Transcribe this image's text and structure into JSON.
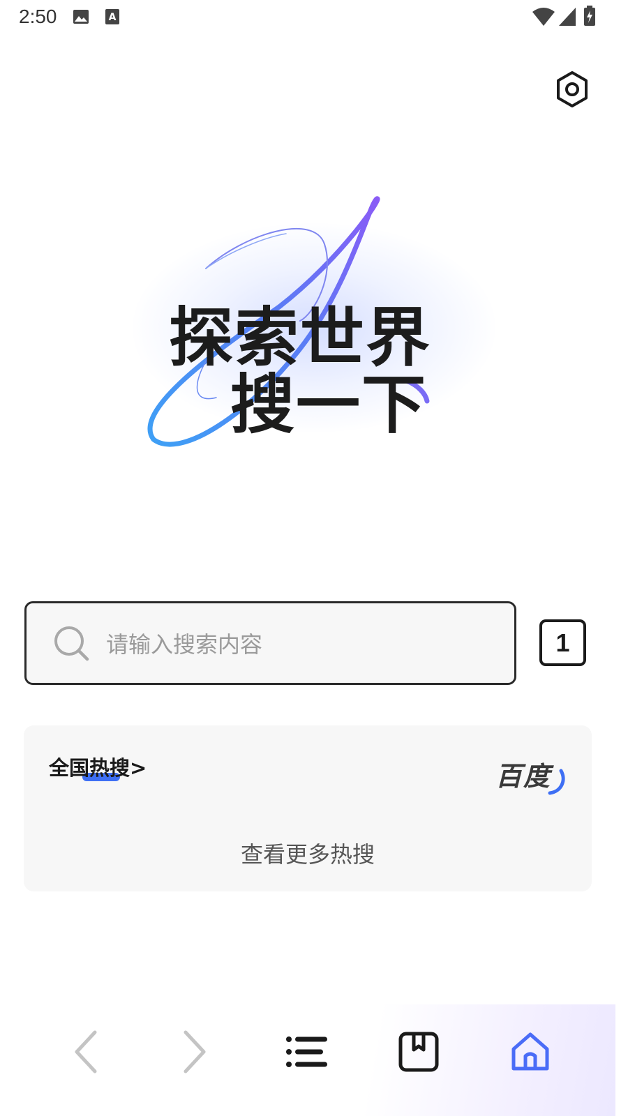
{
  "status_bar": {
    "time": "2:50",
    "icons": [
      "image-icon",
      "text-a-icon",
      "wifi-icon",
      "signal-icon",
      "battery-charging-icon"
    ]
  },
  "header": {
    "settings_icon": "hexagon-settings-icon"
  },
  "hero": {
    "line1": "探索世界",
    "line2": "搜一下",
    "colors": {
      "text": "#1c1c1c",
      "ring_start": "#8a5cf6",
      "ring_end": "#3ea0f5"
    }
  },
  "search": {
    "placeholder": "请输入搜索内容",
    "tab_count": "1"
  },
  "hot_search": {
    "title": "全国热搜>",
    "brand": "百度",
    "more_label": "查看更多热搜",
    "accent": "#3e6ff4"
  },
  "bottom_nav": {
    "items": [
      "back-icon",
      "forward-icon",
      "menu-icon",
      "bookmark-icon",
      "home-icon"
    ],
    "active_color": "#4a6cf7"
  }
}
